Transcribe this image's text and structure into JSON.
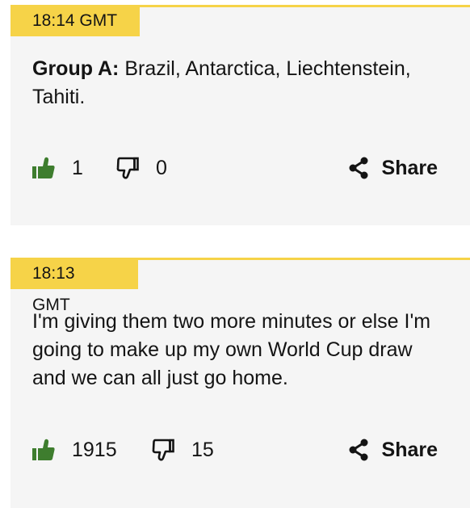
{
  "posts": [
    {
      "time": "18:14 GMT",
      "text_bold": "Group A:",
      "text": " Brazil, Antarctica, Liechtenstein, Tahiti.",
      "likes": "1",
      "dislikes": "0",
      "share_label": "Share"
    },
    {
      "time": "18:13 GMT",
      "text_bold": "",
      "text": "I'm giving them two more minutes or else I'm going to make up my own World Cup draw and we can all just go home.",
      "likes": "1915",
      "dislikes": "15",
      "share_label": "Share"
    }
  ],
  "colors": {
    "accent": "#f6d348",
    "like_green": "#3e7d2e",
    "card_bg": "#f5f5f5"
  },
  "icons": {
    "like": "thumbs-up-icon",
    "dislike": "thumbs-down-icon",
    "share": "share-icon"
  }
}
